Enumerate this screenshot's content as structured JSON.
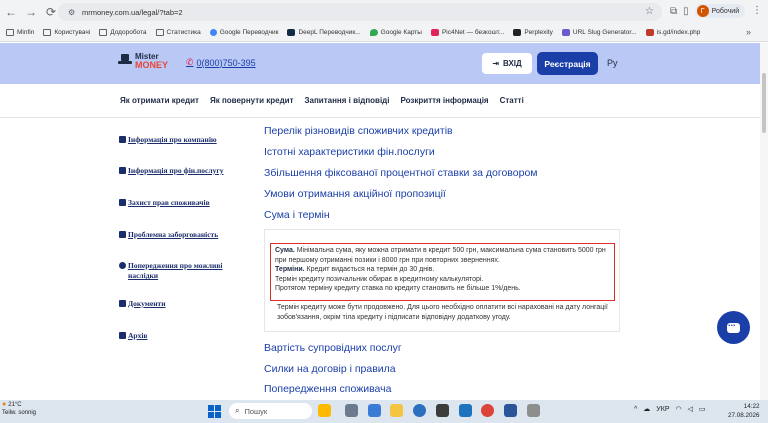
{
  "browser": {
    "url": "mrmoney.com.ua/legal/?tab=2",
    "profile_initial": "Г",
    "profile_name": "Робочий"
  },
  "bookmarks": [
    "Minfin",
    "Користувачі",
    "Додоробота",
    "Статистика",
    "Google Переводчик",
    "DeepL Переводчик...",
    "Google Карты",
    "Pic4Net — безкошт...",
    "Perplexity",
    "URL Slug Generator...",
    "is.gd/index.php"
  ],
  "header": {
    "logo_top": "Mister",
    "logo_bottom": "MONEY",
    "phone": "0(800)750-395",
    "login": "ВХІД",
    "register": "Реєстрація",
    "lang": "Ру"
  },
  "main_nav": [
    "Як отримати кредит",
    "Як повернути кредит",
    "Запитання і відповіді",
    "Розкриття інформація",
    "Статті"
  ],
  "side_menu": [
    "Інформація про компанію",
    "Інформація про фін.послугу",
    "Захист прав споживачів",
    "Проблемна заборгованість",
    "Попередження про можливі наслідки",
    "Документи",
    "Архів"
  ],
  "content_links": [
    "Перелік різновидів споживчих кредитів",
    "Істотні характеристики фін.послуги",
    "Збільшення фіксованої процентної ставки за договором",
    "Умови отримання акційної пропозиції",
    "Сума і термін"
  ],
  "term_section": {
    "sum_label": "Сума.",
    "sum_text": " Мінімальна сума, яку можна отримати в кредит 500 грн, максимальна сума становить 5000 грн при першому отриманні позики і 8000 грн при повторних зверненнях.",
    "term_label": "Терміни.",
    "term_text": " Кредит видається на термін до 30 днів.",
    "line3": "Термін кредиту позичальник обирає в кредитному калькуляторі.",
    "line4": "Протягом терміну кредиту ставка по кредиту становить не більше 1%/день.",
    "extra": "Термін кредиту може бути продовжено. Для цього необхідно оплатити всі нараховані на дату лонгації зобов'язання, окрім тіла кредиту і підписати відповідну додаткову угоду."
  },
  "content_links_after": [
    "Вартість супровідних послуг",
    "Силки на договір і правила",
    "Попередження споживача"
  ],
  "taskbar": {
    "temp": "21°C",
    "weather": "Teilw. sonnig",
    "search": "Пошук",
    "lang": "УКР",
    "time": "14:22",
    "date": "27.08.2026"
  }
}
